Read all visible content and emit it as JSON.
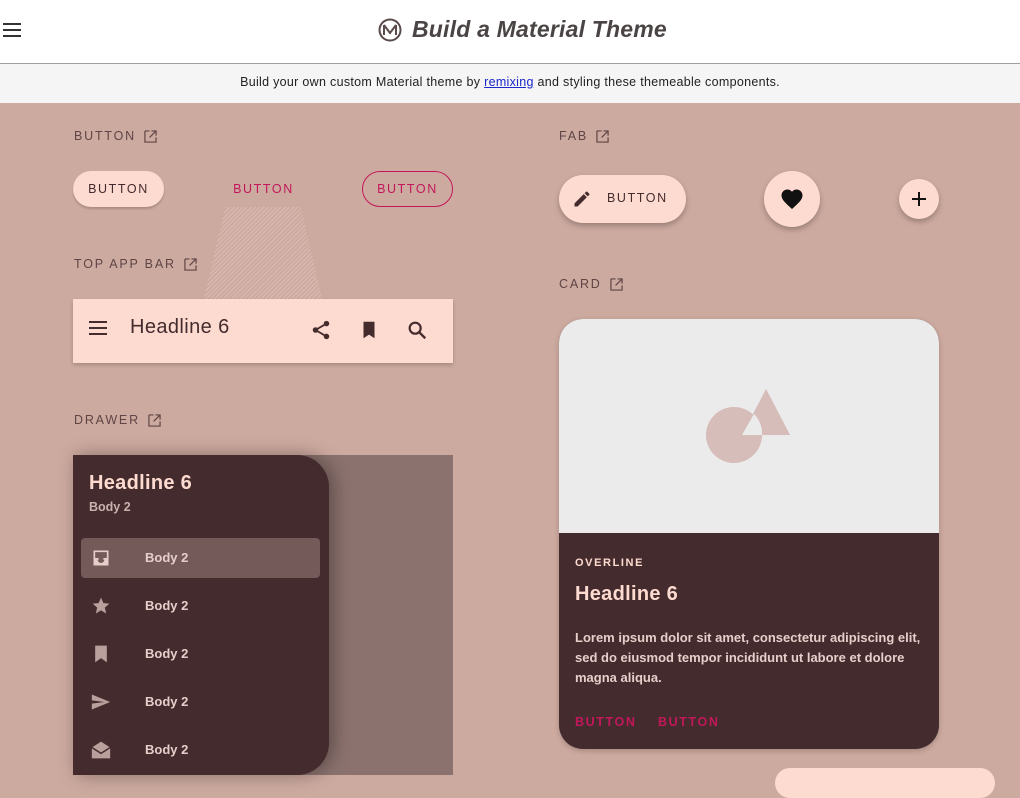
{
  "topbar": {
    "title": "Build a Material Theme"
  },
  "infobar": {
    "before": "Build your own custom Material theme by ",
    "link": "remixing",
    "after": " and styling these themeable components."
  },
  "sections": {
    "button": "BUTTON",
    "top_app_bar": "TOP APP BAR",
    "drawer": "DRAWER",
    "fab": "FAB",
    "card": "CARD"
  },
  "buttons": {
    "contained": "BUTTON",
    "text": "BUTTON",
    "outlined": "BUTTON"
  },
  "appbar": {
    "title": "Headline 6",
    "actions": [
      "share-icon",
      "bookmark-icon",
      "search-icon"
    ]
  },
  "drawer": {
    "title": "Headline 6",
    "subtitle": "Body 2",
    "items": [
      {
        "icon": "inbox-icon",
        "label": "Body 2",
        "active": true
      },
      {
        "icon": "star-icon",
        "label": "Body 2",
        "active": false
      },
      {
        "icon": "bookmark-icon",
        "label": "Body 2",
        "active": false
      },
      {
        "icon": "send-icon",
        "label": "Body 2",
        "active": false
      },
      {
        "icon": "drafts-icon",
        "label": "Body 2",
        "active": false
      }
    ]
  },
  "fab": {
    "extended_label": "BUTTON",
    "extended_icon": "edit-icon",
    "regular_icon": "favorite-icon",
    "mini_icon": "add-icon"
  },
  "card": {
    "overline": "OVERLINE",
    "title": "Headline 6",
    "body": "Lorem ipsum dolor sit amet, consectetur adipiscing elit, sed do eiusmod tempor incididunt ut labore et dolore magna aliqua.",
    "button_1": "BUTTON",
    "button_2": "BUTTON"
  },
  "colors": {
    "background": "#cdaaa0",
    "surface": "#fedbd0",
    "on_surface": "#442b2d",
    "accent": "#c2185b",
    "drawer_active": "#745b5a"
  }
}
